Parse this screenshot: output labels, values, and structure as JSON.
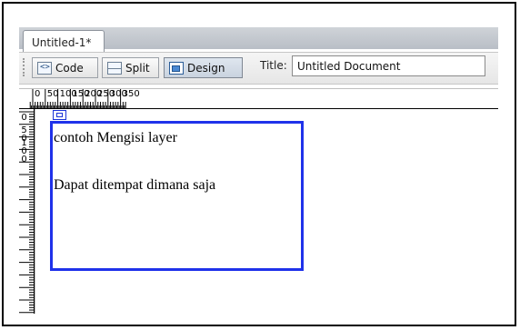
{
  "document": {
    "tab_label": "Untitled-1*"
  },
  "toolbar": {
    "code_label": "Code",
    "split_label": "Split",
    "design_label": "Design",
    "title_label": "Title:",
    "title_value": "Untitled Document",
    "active_view": "Design"
  },
  "rulers": {
    "horizontal": [
      "0",
      "50",
      "100",
      "150",
      "200",
      "250",
      "300",
      "350"
    ],
    "vertical": [
      {
        "chars": [
          "0"
        ]
      },
      {
        "chars": [
          "5",
          "0"
        ]
      },
      {
        "chars": [
          "1",
          "0",
          "0"
        ]
      }
    ]
  },
  "layer": {
    "line1": "contoh Mengisi layer",
    "line2": "Dapat ditempat dimana saja",
    "border_color": "#1f32ea"
  },
  "colors": {
    "accent": "#1f32ea",
    "tab_strip": "#c4c9d0"
  }
}
